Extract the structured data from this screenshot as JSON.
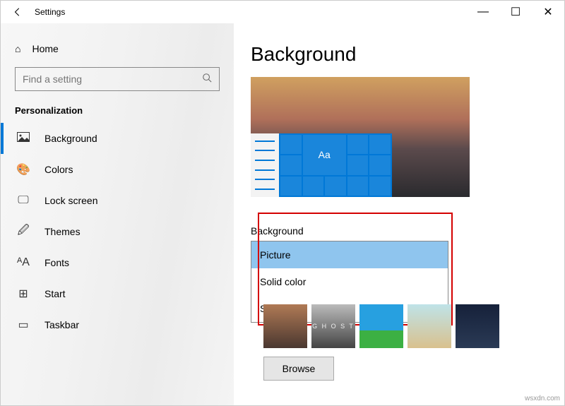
{
  "window": {
    "title": "Settings"
  },
  "winbuttons": {
    "min": "—",
    "max": "☐",
    "close": "✕"
  },
  "sidebar": {
    "home": "Home",
    "search_placeholder": "Find a setting",
    "section": "Personalization",
    "items": [
      {
        "icon": "⌶",
        "label": "Background"
      },
      {
        "icon": "🎨",
        "label": "Colors"
      },
      {
        "icon": "🖵",
        "label": "Lock screen"
      },
      {
        "icon": "🖉",
        "label": "Themes"
      },
      {
        "icon": "ᴬA",
        "label": "Fonts"
      },
      {
        "icon": "⊞",
        "label": "Start"
      },
      {
        "icon": "▭",
        "label": "Taskbar"
      }
    ]
  },
  "main": {
    "heading": "Background",
    "preview_sample": "Aa",
    "dropdown_label": "Background",
    "options": [
      "Picture",
      "Solid color",
      "Slideshow"
    ],
    "selected": "Picture",
    "browse": "Browse",
    "thumb_ghost": "G H O S T"
  },
  "watermark": "wsxdn.com"
}
